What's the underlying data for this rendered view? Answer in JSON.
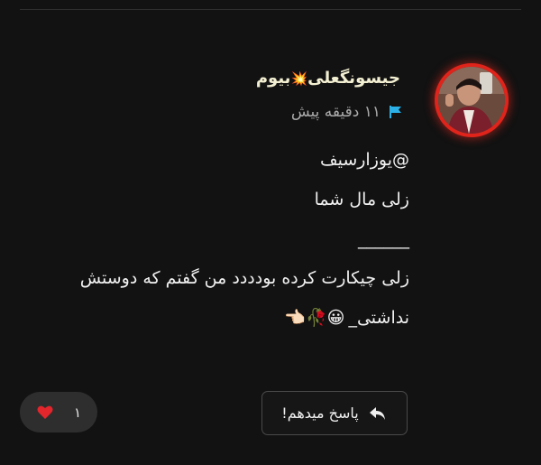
{
  "comment": {
    "author": "جیسونگعلی",
    "author_suffix": "بیوم",
    "author_emoji": "💥",
    "timestamp": "۱۱ دقیقه پیش",
    "flag_icon": "flag-icon",
    "lines": [
      "@یوزارسیف",
      "زلی مال شما",
      "______",
      "زلی چیکارت کرده بودددد من گفتم که دوستش",
      "نداشتی_"
    ],
    "line5_emojis": "😀🥀👈🏻"
  },
  "actions": {
    "reply_label": "پاسخ میدهم!",
    "reply_icon": "reply-arrow-icon",
    "like_count": "۱",
    "like_icon": "heart-icon",
    "heart_color": "#e3252c"
  },
  "colors": {
    "background": "#121212",
    "avatar_ring": "#e0241b",
    "username": "#f3efd2",
    "flag": "#2bb0e8"
  }
}
